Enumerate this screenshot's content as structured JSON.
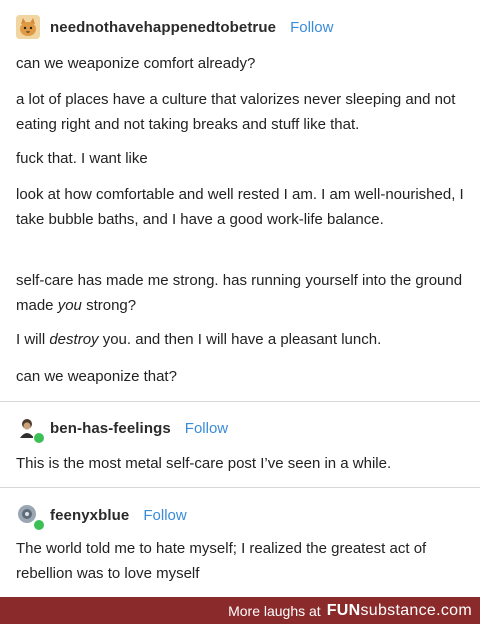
{
  "posts": [
    {
      "username": "neednothavehappenedtobetrue",
      "follow": "Follow",
      "avatar_icon": "cat-avatar-icon",
      "paragraphs": [
        "can we weaponize comfort already?",
        "a lot of places have a culture that valorizes never sleeping and not eating right and not taking breaks and stuff like that.",
        "fuck that. I want like",
        "look at how comfortable and well rested I am. I am well-nourished, I take bubble baths, and I have a good work-life balance.",
        "self-care has made me strong. has running yourself into the ground made",
        "you",
        "strong?",
        "I will",
        "destroy",
        "you. and then I will have a pleasant lunch.",
        "can we weaponize that?"
      ]
    },
    {
      "username": "ben-has-feelings",
      "follow": "Follow",
      "avatar_icon": "person-avatar-icon",
      "paragraphs": [
        "This is the most metal self-care post I’ve seen in a while."
      ]
    },
    {
      "username": "feenyxblue",
      "follow": "Follow",
      "avatar_icon": "gear-avatar-icon",
      "paragraphs": [
        "The world told me to hate myself; I realized the greatest act of rebellion was to love myself"
      ]
    }
  ],
  "footer": {
    "more": "More laughs at",
    "brand_bold": "FUN",
    "brand_light": "substance.com"
  },
  "colors": {
    "follow": "#3a8bd8",
    "footer_bg": "#8b2a2b",
    "reblog_badge": "#3cbf55"
  }
}
